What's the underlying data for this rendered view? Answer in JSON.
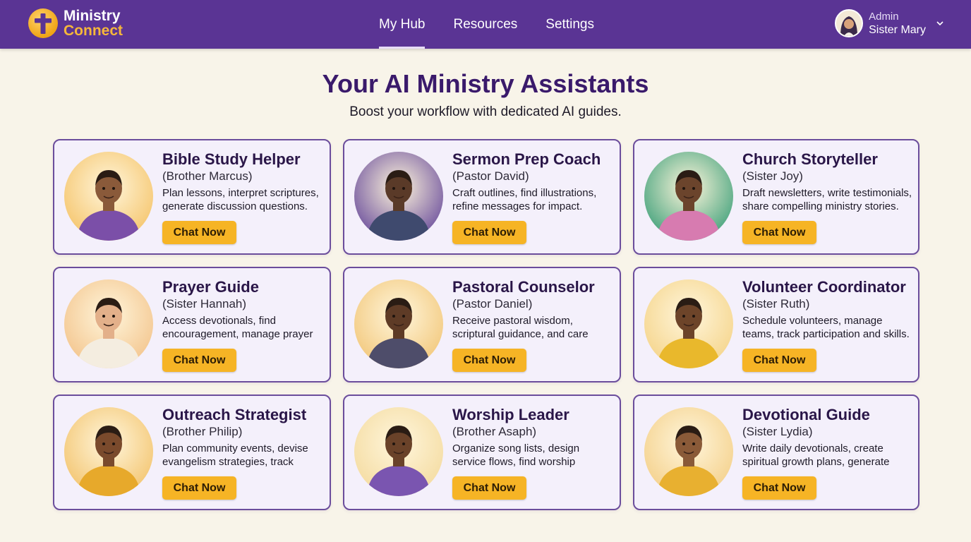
{
  "app": {
    "brand_line1": "Ministry",
    "brand_line2": "Connect"
  },
  "nav": {
    "tabs": [
      {
        "label": "My Hub",
        "active": true
      },
      {
        "label": "Resources",
        "active": false
      },
      {
        "label": "Settings",
        "active": false
      }
    ]
  },
  "user": {
    "role": "Admin",
    "name": "Sister Mary"
  },
  "main": {
    "title": "Your AI Ministry Assistants",
    "subtitle": "Boost your workflow with dedicated AI guides."
  },
  "assistants": [
    {
      "title": "Bible Study Helper",
      "persona": "(Brother Marcus)",
      "description": "Plan lessons, interpret scriptures, generate discussion questions.",
      "button": "Chat Now",
      "portrait_icon": "scroll-reader-portrait",
      "bg": "#f5c46a",
      "skin": "#8a5a3a",
      "robe": "#7b4fa8"
    },
    {
      "title": "Sermon Prep Coach",
      "persona": "(Pastor David)",
      "description": "Craft outlines, find illustrations, refine messages for impact.",
      "button": "Chat Now",
      "portrait_icon": "pulpit-speaker-portrait",
      "bg": "#6a4d9c",
      "skin": "#5a3a28",
      "robe": "#3f4a6e"
    },
    {
      "title": "Church Storyteller",
      "persona": "(Sister Joy)",
      "description": "Draft newsletters, write testimonials, share compelling ministry stories.",
      "button": "Chat Now",
      "portrait_icon": "storyteller-portrait",
      "bg": "#3fa07a",
      "skin": "#6b442c",
      "robe": "#d77bb0"
    },
    {
      "title": "Prayer Guide",
      "persona": "(Sister Hannah)",
      "description": "Access devotionals, find encouragement, manage prayer",
      "button": "Chat Now",
      "portrait_icon": "praying-woman-portrait",
      "bg": "#f3c48c",
      "skin": "#e3b08a",
      "robe": "#f4ede0"
    },
    {
      "title": "Pastoral Counselor",
      "persona": "(Pastor Daniel)",
      "description": "Receive pastoral wisdom, scriptural guidance, and care resources.",
      "button": "Chat Now",
      "portrait_icon": "counselor-portrait",
      "bg": "#f2c77a",
      "skin": "#5e3b26",
      "robe": "#4e4d6a"
    },
    {
      "title": "Volunteer Coordinator",
      "persona": "(Sister Ruth)",
      "description": "Schedule volunteers, manage teams, track participation and skills.",
      "button": "Chat Now",
      "portrait_icon": "volunteer-team-portrait",
      "bg": "#f5d48a",
      "skin": "#6d4429",
      "robe": "#e9b82c"
    },
    {
      "title": "Outreach Strategist",
      "persona": "(Brother Philip)",
      "description": "Plan community events, devise evangelism strategies, track impact.",
      "button": "Chat Now",
      "portrait_icon": "globe-compass-portrait",
      "bg": "#f3c46e",
      "skin": "#7a4a2c",
      "robe": "#e7a92b"
    },
    {
      "title": "Worship Leader",
      "persona": "(Brother Asaph)",
      "description": "Organize song lists, design service flows, find worship resources.",
      "button": "Chat Now",
      "portrait_icon": "guitar-player-portrait",
      "bg": "#f4dba0",
      "skin": "#6a4229",
      "robe": "#7a55b0"
    },
    {
      "title": "Devotional Guide",
      "persona": "(Sister Lydia)",
      "description": "Write daily devotionals, create spiritual growth plans, generate reflections.",
      "button": "Chat Now",
      "portrait_icon": "reading-woman-portrait",
      "bg": "#f4d08a",
      "skin": "#8a5a38",
      "robe": "#e8b030"
    }
  ]
}
